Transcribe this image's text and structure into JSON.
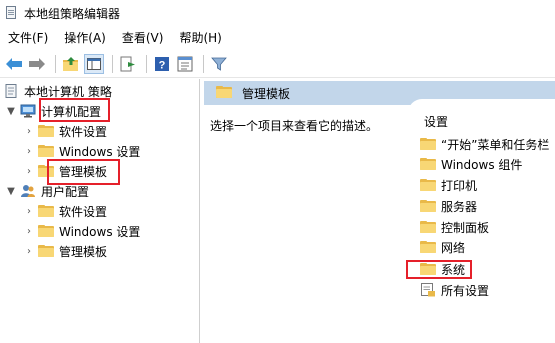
{
  "window": {
    "title": "本地组策略编辑器"
  },
  "menu": [
    "文件(F)",
    "操作(A)",
    "查看(V)",
    "帮助(H)"
  ],
  "tree": {
    "root": "本地计算机 策略",
    "computer": "计算机配置",
    "computer_children": [
      "软件设置",
      "Windows 设置",
      "管理模板"
    ],
    "user": "用户配置",
    "user_children": [
      "软件设置",
      "Windows 设置",
      "管理模板"
    ]
  },
  "details": {
    "header": "管理模板",
    "description": "选择一个项目来查看它的描述。",
    "column": "设置",
    "items": [
      "“开始”菜单和任务栏",
      "Windows 组件",
      "打印机",
      "服务器",
      "控制面板",
      "网络",
      "系统",
      "所有设置"
    ]
  },
  "colors": {
    "highlight": "#e5202a",
    "header": "#c2d6ea",
    "folder": "#f8d775"
  }
}
